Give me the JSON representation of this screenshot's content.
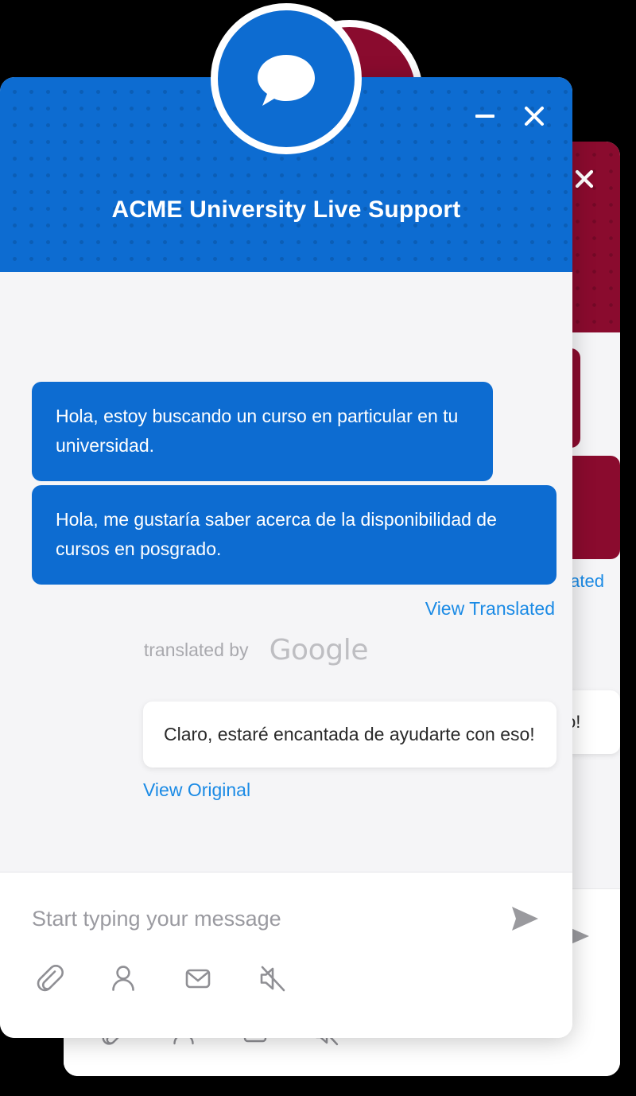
{
  "background_window": {
    "header": {
      "color": "#8A0B2E",
      "close_label": "×"
    },
    "messages": [
      {
        "sender": "visitor",
        "text": ""
      },
      {
        "sender": "visitor",
        "text": ""
      }
    ],
    "view_translated_label": "View Translated",
    "agent_message": "Claro, estaré encantada de ayudarte con eso!",
    "toolbar": {
      "icons": [
        "paperclip-icon",
        "person-icon",
        "envelope-icon",
        "mute-icon"
      ],
      "send_icon": "send-icon"
    }
  },
  "foreground_window": {
    "header": {
      "title": "ACME University Live Support",
      "color": "#0D6CD1",
      "minimize_label": "—",
      "close_label": "×",
      "avatar_icon": "chat-bubble-icon"
    },
    "messages": [
      {
        "sender": "visitor",
        "text": "Hola, estoy buscando un curso en particular en tu universidad."
      },
      {
        "sender": "visitor",
        "text": "Hola, me gustaría saber acerca de la disponibilidad de cursos en posgrado."
      }
    ],
    "view_translated_label": "View Translated",
    "translation_attribution": {
      "prefix": "translated by",
      "provider": "Google"
    },
    "agent_message": {
      "sender": "agent",
      "text": "Claro, estaré encantada de ayudarte con eso!"
    },
    "view_original_label": "View Original",
    "composer": {
      "placeholder": "Start typing your message",
      "value": "",
      "send_icon": "send-icon"
    },
    "toolbar": {
      "icons": [
        {
          "name": "paperclip-icon",
          "label": "Attach file"
        },
        {
          "name": "person-icon",
          "label": "Visitor info"
        },
        {
          "name": "envelope-icon",
          "label": "Email transcript"
        },
        {
          "name": "mute-icon",
          "label": "Mute sound"
        }
      ]
    }
  },
  "colors": {
    "brand_blue": "#0D6CD1",
    "brand_maroon": "#8A0B2E",
    "link_blue": "#1A8AE5",
    "chat_background": "#F5F5F7",
    "muted_grey": "#A9A9AE"
  }
}
